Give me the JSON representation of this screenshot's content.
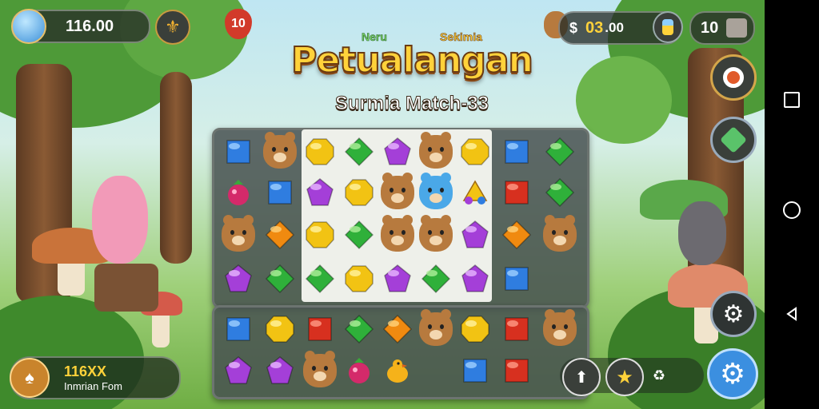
{
  "hud": {
    "coins": "116.00",
    "lives": "10",
    "resource": "03",
    "resource_decimal": ".00",
    "moves": "10"
  },
  "title": {
    "tag_left": "Neru",
    "tag_right": "Sekimia",
    "main": "Petualangan",
    "sub": "Surmia Match-33"
  },
  "bottom_left": {
    "value": "116XX",
    "label": "Inmrian Fom"
  },
  "bottom_right": {
    "cycle_glyph": "♻"
  },
  "colors": {
    "gold": "#ffd23a",
    "pill_bg": "#2d322d",
    "gear_blue": "#3b8fe0"
  },
  "icons": [
    "crystal-icon",
    "fleur-icon",
    "heart-icon",
    "bear-icon",
    "dollar-icon",
    "potion-icon",
    "cart-icon",
    "target-icon",
    "tool-icon",
    "gear-icon",
    "spade-icon",
    "arrow-up-icon",
    "star-icon",
    "cycle-icon",
    "square-nav-icon",
    "circle-nav-icon",
    "back-nav-icon"
  ],
  "board": [
    [
      "blue-gem",
      "bear",
      "yellow-gem",
      "green-gem",
      "purple-gem",
      "bear",
      "yellow-gem",
      "blue-gem",
      "green-gem"
    ],
    [
      "berry",
      "blue-gem",
      "purple-gem",
      "yellow-gem",
      "bear",
      "blue-bear",
      "candy",
      "red-gem",
      "green-gem"
    ],
    [
      "bear",
      "orange-gem",
      "yellow-gem",
      "green-gem",
      "bear",
      "bear",
      "purple-gem",
      "orange-gem",
      "bear"
    ],
    [
      "purple-gem",
      "green-gem",
      "green-gem",
      "yellow-gem",
      "purple-gem",
      "green-gem",
      "purple-gem",
      "blue-gem",
      "none"
    ],
    [
      "blue-gem",
      "yellow-gem",
      "red-gem",
      "green-gem",
      "orange-gem",
      "bear",
      "yellow-gem",
      "red-gem",
      "bear"
    ],
    [
      "purple-gem",
      "purple-gem",
      "bear",
      "berry",
      "bird",
      "none",
      "blue-gem",
      "red-gem",
      "none"
    ]
  ]
}
